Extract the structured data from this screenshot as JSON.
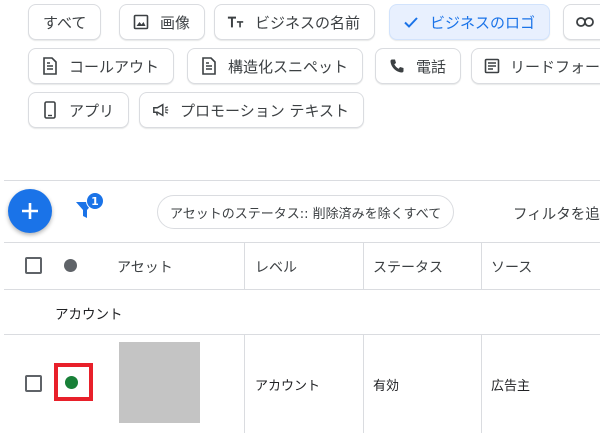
{
  "chips": {
    "all": "すべて",
    "image": "画像",
    "business_name": "ビジネスの名前",
    "business_logo": "ビジネスのロゴ",
    "callout": "コールアウト",
    "structured_snippet": "構造化スニペット",
    "phone": "電話",
    "lead_form": "リードフォーム",
    "app": "アプリ",
    "promotion_text": "プロモーション テキスト"
  },
  "toolbar": {
    "filter_badge": "1",
    "status_filter": "アセットのステータス:: 削除済みを除くすべて",
    "add_filter": "フィルタを追加"
  },
  "table": {
    "headers": {
      "asset": "アセット",
      "level": "レベル",
      "status": "ステータス",
      "source": "ソース"
    },
    "group_label": "アカウント",
    "row": {
      "level": "アカウント",
      "status": "有効",
      "source": "広告主"
    }
  },
  "colors": {
    "accent": "#1a73e8",
    "status_active": "#188038",
    "highlight": "#e8202a"
  }
}
